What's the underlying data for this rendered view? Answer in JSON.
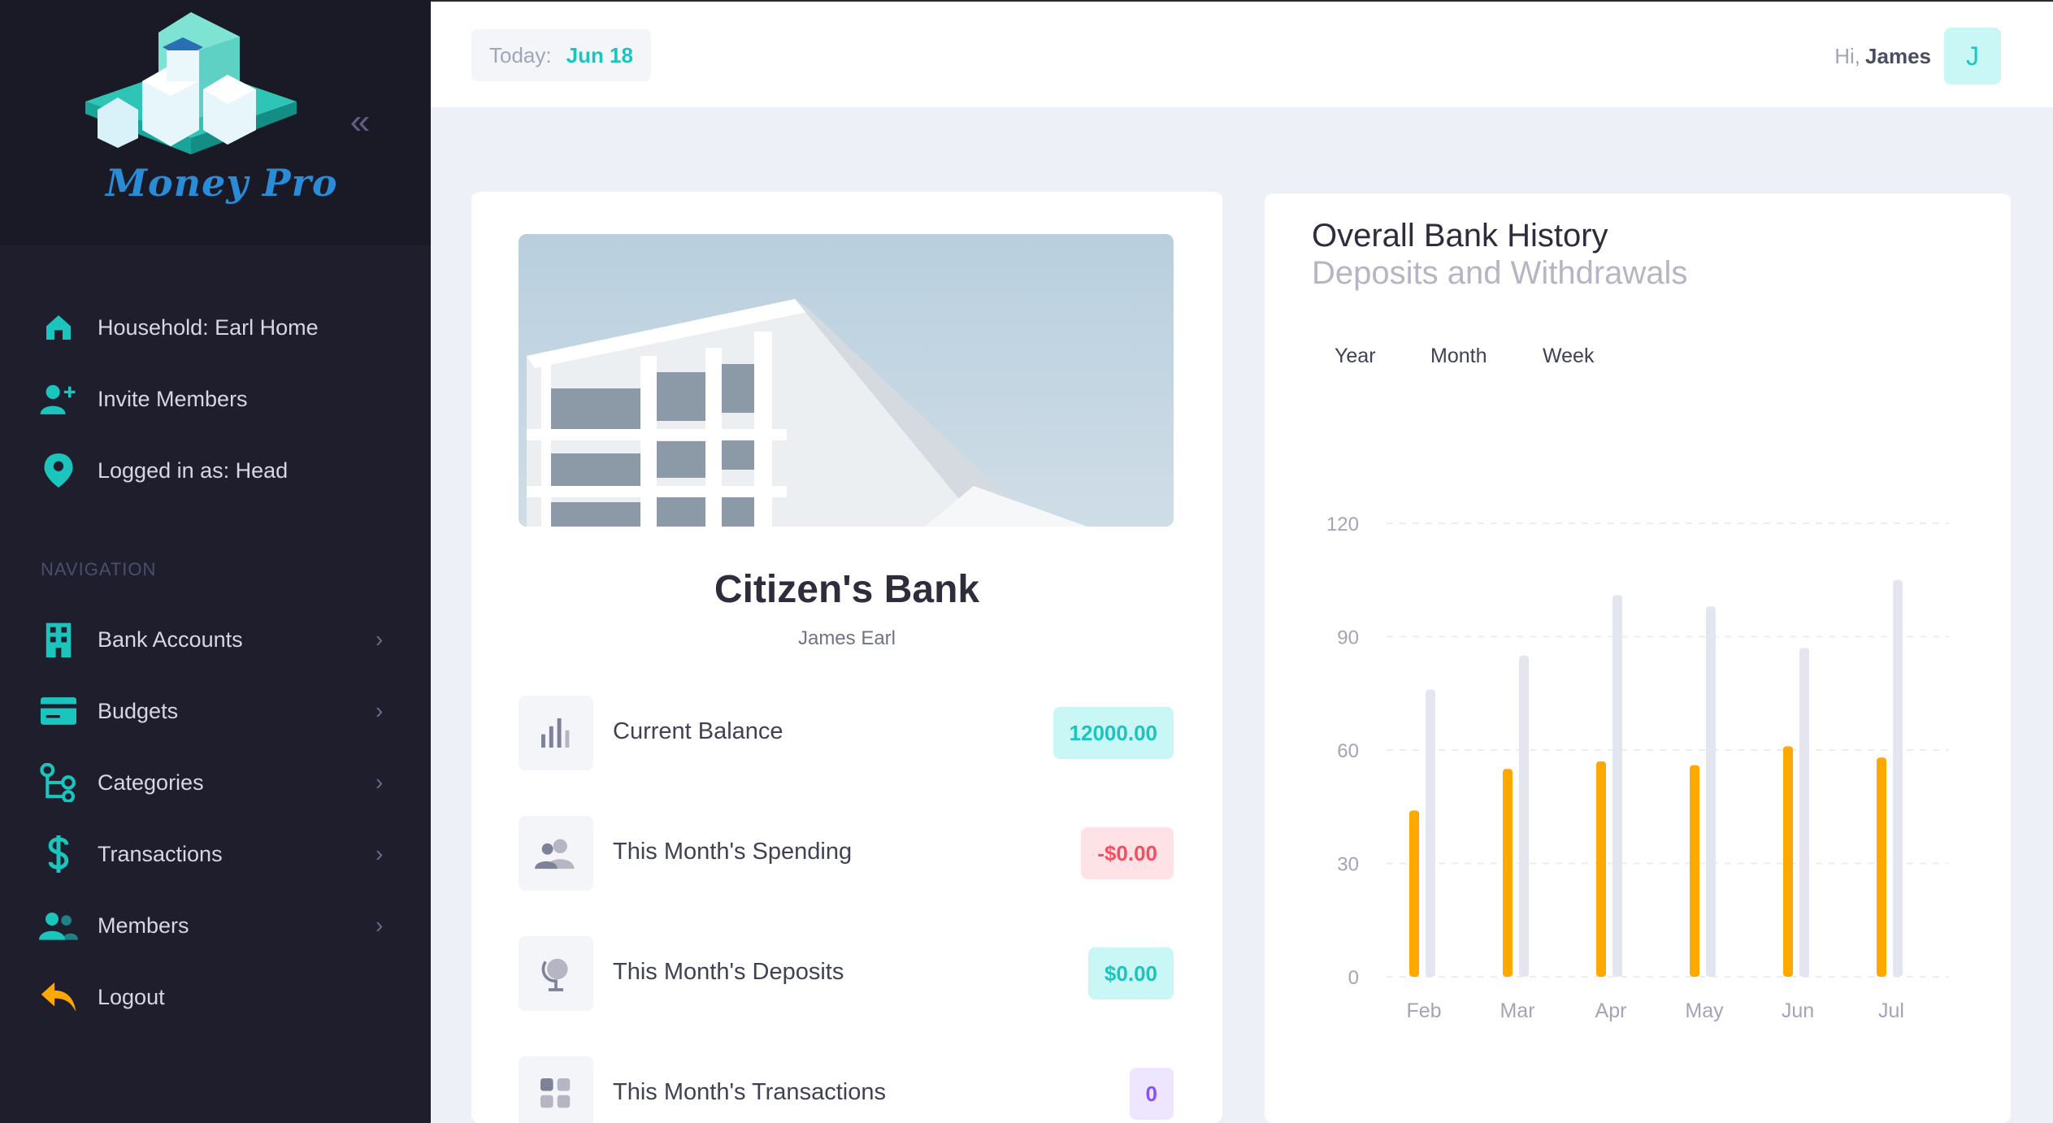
{
  "app": {
    "name": "Money Pro"
  },
  "sidebar": {
    "collapse_glyph": "«",
    "info": [
      {
        "label": "Household: Earl Home",
        "icon": "home-icon"
      },
      {
        "label": "Invite Members",
        "icon": "add-user-icon"
      },
      {
        "label": "Logged in as: Head",
        "icon": "location-pin-icon"
      }
    ],
    "nav_heading": "NAVIGATION",
    "nav": [
      {
        "label": "Bank Accounts",
        "icon": "building-icon"
      },
      {
        "label": "Budgets",
        "icon": "credit-card-icon"
      },
      {
        "label": "Categories",
        "icon": "hierarchy-icon"
      },
      {
        "label": "Transactions",
        "icon": "dollar-icon"
      },
      {
        "label": "Members",
        "icon": "group-icon"
      }
    ],
    "logout": {
      "label": "Logout",
      "icon": "logout-arrow-icon"
    },
    "chevron": "›"
  },
  "topbar": {
    "today_label": "Today:",
    "today_value": "Jun 18",
    "greeting": "Hi,",
    "user_name": "James",
    "avatar_letter": "J"
  },
  "bank": {
    "title": "Citizen's Bank",
    "owner": "James Earl",
    "stats": [
      {
        "label": "Current Balance",
        "value": "12000.00",
        "icon": "bar-chart-icon"
      },
      {
        "label": "This Month's Spending",
        "value": "-$0.00",
        "icon": "group-icon"
      },
      {
        "label": "This Month's Deposits",
        "value": "$0.00",
        "icon": "globe-icon"
      },
      {
        "label": "This Month's Transactions",
        "value": "0",
        "icon": "grid-icon"
      }
    ]
  },
  "colors": {
    "accent": "#1bc5bd",
    "accent_light": "#c9f7f5",
    "danger": "#f64e60",
    "danger_light": "#ffe2e5",
    "purple": "#8950fc",
    "purple_light": "#eee5ff",
    "bar_primary": "#ffa800",
    "bar_secondary": "#e4e6ef",
    "logout": "#ffa800"
  },
  "chart_panel": {
    "tabs": [
      "Year",
      "Month",
      "Week"
    ]
  },
  "chart_data": {
    "type": "bar",
    "title": "Overall Bank History",
    "subtitle": "Deposits and Withdrawals",
    "categories": [
      "Feb",
      "Mar",
      "Apr",
      "May",
      "Jun",
      "Jul"
    ],
    "series": [
      {
        "values": [
          44,
          55,
          57,
          56,
          61,
          58
        ]
      },
      {
        "values": [
          76,
          85,
          101,
          98,
          87,
          105
        ]
      }
    ],
    "ylim": [
      0,
      120
    ],
    "yticks": [
      0,
      30,
      60,
      90,
      120
    ],
    "grid": true
  }
}
